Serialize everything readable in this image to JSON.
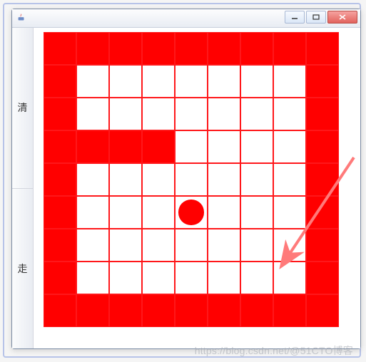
{
  "window": {
    "title": "",
    "app_icon": "java-icon",
    "controls": {
      "min": "min",
      "max": "max",
      "close": "close"
    }
  },
  "sidebar": {
    "buttons": [
      {
        "id": "clear",
        "label": "清"
      },
      {
        "id": "go",
        "label": "走"
      }
    ]
  },
  "board": {
    "cols": 9,
    "rows": 9,
    "colors": {
      "wall": "#ff0000",
      "empty": "#ffffff",
      "grid_line": "#ff171a",
      "ball": "#ff0000"
    },
    "cells": [
      [
        1,
        1,
        1,
        1,
        1,
        1,
        1,
        1,
        1
      ],
      [
        1,
        0,
        0,
        0,
        0,
        0,
        0,
        0,
        1
      ],
      [
        1,
        0,
        0,
        0,
        0,
        0,
        0,
        0,
        1
      ],
      [
        1,
        1,
        1,
        1,
        0,
        0,
        0,
        0,
        1
      ],
      [
        1,
        0,
        0,
        0,
        0,
        0,
        0,
        0,
        1
      ],
      [
        1,
        0,
        0,
        0,
        2,
        0,
        0,
        0,
        1
      ],
      [
        1,
        0,
        0,
        0,
        0,
        0,
        0,
        0,
        1
      ],
      [
        1,
        0,
        0,
        0,
        0,
        0,
        0,
        0,
        1
      ],
      [
        1,
        1,
        1,
        1,
        1,
        1,
        1,
        1,
        1
      ]
    ],
    "legend": {
      "0": "empty",
      "1": "wall",
      "2": "ball"
    }
  },
  "annotation": {
    "arrow": {
      "from": [
        498,
        200
      ],
      "to": [
        398,
        362
      ],
      "color": "#ff6a6a"
    }
  },
  "watermark": "https://blog.csdn.net/@51CTO博客"
}
